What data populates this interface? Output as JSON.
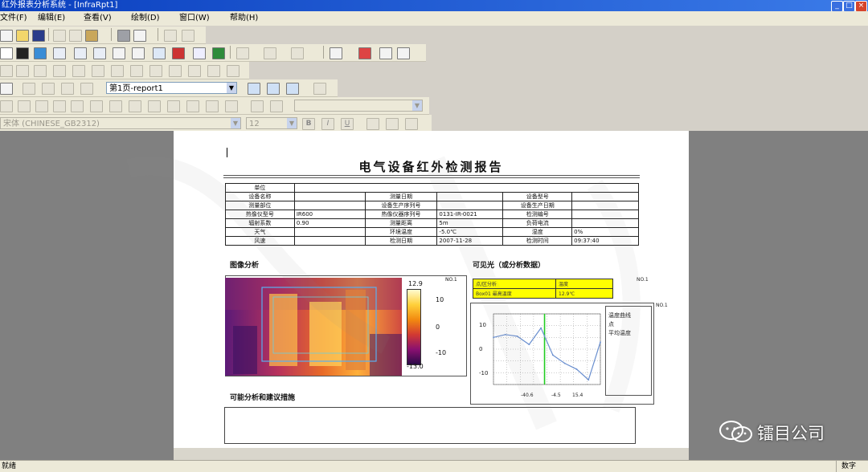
{
  "window": {
    "title": "红外报表分析系统 - [InfraRpt1]",
    "buttons": [
      "_",
      "□",
      "×"
    ]
  },
  "menu": [
    "文件(F)",
    "编辑(E)",
    "查看(V)",
    "绘制(D)",
    "窗口(W)",
    "帮助(H)"
  ],
  "navbar": {
    "page_select": "第1页-report1",
    "font_name": "宋体 (CHINESE_GB2312)",
    "font_size": "12",
    "format_b": "B",
    "format_i": "I",
    "format_u": "U"
  },
  "report": {
    "title": "电气设备红外检测报告",
    "table_rows": [
      [
        "单位",
        "",
        "",
        "",
        "",
        ""
      ],
      [
        "设备名称",
        "",
        "测量日期",
        "",
        "设备型号",
        ""
      ],
      [
        "测量部位",
        "",
        "设备生产序列号",
        "",
        "设备生产日期",
        ""
      ],
      [
        "热像仪型号",
        "IR600",
        "热像仪器序列号",
        "0131-IR-0021",
        "检测编号",
        ""
      ],
      [
        "辐射系数",
        "0.90",
        "测量距离",
        "5m",
        "负荷电流",
        ""
      ],
      [
        "天气",
        "",
        "环境温度",
        "-5.0℃",
        "湿度",
        "0%"
      ],
      [
        "风速",
        "",
        "检测日期",
        "2007-11-28",
        "检测时间",
        "09:37:40"
      ]
    ],
    "section_image": "图像分析",
    "section_visible": "可见光（或分析数据）",
    "section_remark": "可能分析和建议措施",
    "thermal": {
      "box_label": "NO.1",
      "scale_max": "12.9",
      "scale_ticks": [
        "10",
        "0",
        "-10"
      ],
      "scale_min": "-13.0"
    },
    "analysis_table": {
      "box_label": "NO.1",
      "rows": [
        [
          "点/区分析",
          "温度"
        ],
        [
          "Box01 最高温度",
          "12.9℃"
        ]
      ]
    },
    "line_chart": {
      "box_label": "NO.1",
      "legend": [
        "温度曲线",
        "点",
        "平均温度"
      ],
      "y_ticks": [
        "10",
        "0",
        "-10"
      ],
      "x_ticks": [
        "-40.6",
        "-4.5",
        "15.4"
      ]
    }
  },
  "chart_data": {
    "type": "line",
    "x": [
      0,
      1,
      2,
      3,
      4,
      5,
      6,
      7,
      8,
      9
    ],
    "series": [
      {
        "values": [
          5.0,
          6.2,
          5.5,
          2.0,
          9.0,
          -2.5,
          -6.0,
          -8.5,
          -13.0,
          3.0
        ]
      }
    ],
    "markers": [
      {
        "x": 4.3,
        "color": "#22cc22"
      }
    ],
    "ylim": [
      -15,
      15
    ],
    "grid": true,
    "line_color": "#6a8fcf"
  },
  "statusbar": {
    "left": "就绪",
    "right": "数字"
  },
  "watermark": {
    "text": "镭目公司"
  },
  "colors": {
    "title_bar": "#0a3fbf",
    "workspace": "#808080",
    "highlight": "#ffff00"
  }
}
